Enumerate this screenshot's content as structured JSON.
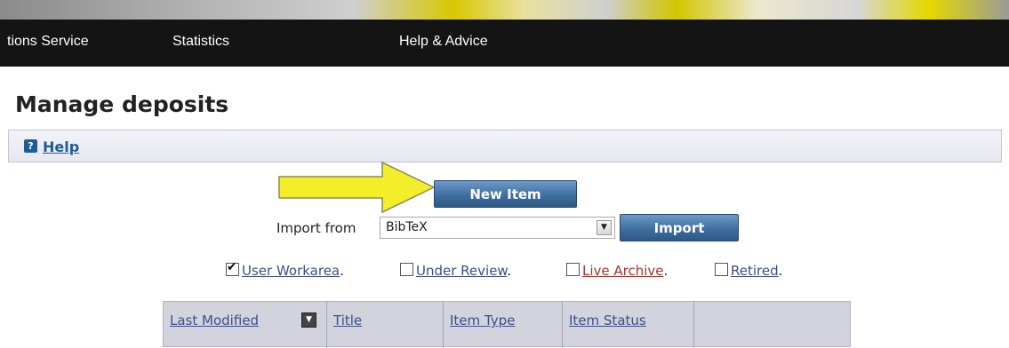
{
  "nav": {
    "items": [
      {
        "label": "tions Service"
      },
      {
        "label": "Statistics"
      },
      {
        "label": "Help & Advice"
      }
    ]
  },
  "page": {
    "title": "Manage deposits"
  },
  "help": {
    "label": "Help",
    "icon": "help-question-icon"
  },
  "actions": {
    "new_item_label": "New Item",
    "import_label": "Import from",
    "import_format": "BibTeX",
    "import_button_label": "Import"
  },
  "filters": [
    {
      "label": "User Workarea",
      "checked": true
    },
    {
      "label": "Under Review",
      "checked": false
    },
    {
      "label": "Live Archive",
      "checked": false
    },
    {
      "label": "Retired",
      "checked": false
    }
  ],
  "filter_separator": ".",
  "table": {
    "columns": [
      "Last Modified",
      "Title",
      "Item Type",
      "Item Status"
    ]
  },
  "colors": {
    "nav_bg": "#141414",
    "button_blue": "#3f6f9f",
    "arrow_yellow": "#f2ee2a",
    "link_blue": "#3b4f8a",
    "link_red": "#a8322d"
  }
}
